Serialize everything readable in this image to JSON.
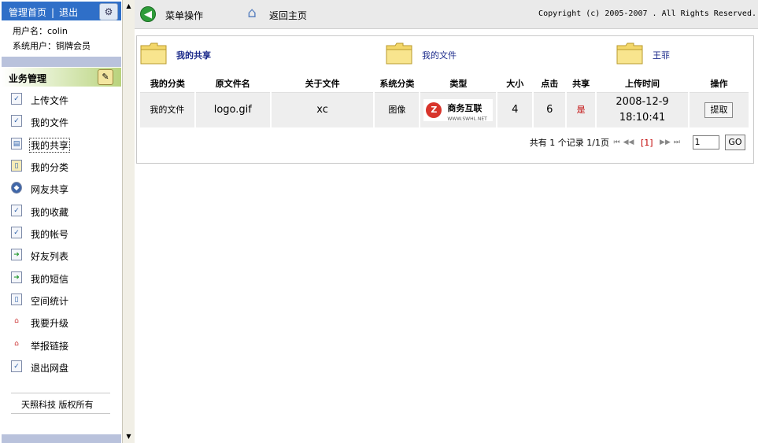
{
  "sidebar": {
    "top_home": "管理首页",
    "top_sep": "|",
    "top_logout": "退出",
    "username_line": "用户名：colin",
    "role_line": "系统用户：铜牌会员",
    "section_title": "业务管理",
    "items": [
      {
        "label": "上传文件",
        "icon": "upload-file-icon"
      },
      {
        "label": "我的文件",
        "icon": "my-files-icon"
      },
      {
        "label": "我的共享",
        "icon": "my-share-icon"
      },
      {
        "label": "我的分类",
        "icon": "category-icon"
      },
      {
        "label": "网友共享",
        "icon": "friend-share-icon"
      },
      {
        "label": "我的收藏",
        "icon": "favorites-icon"
      },
      {
        "label": "我的帐号",
        "icon": "account-icon"
      },
      {
        "label": "好友列表",
        "icon": "friends-list-icon"
      },
      {
        "label": "我的短信",
        "icon": "messages-icon"
      },
      {
        "label": "空间统计",
        "icon": "space-stats-icon"
      },
      {
        "label": "我要升级",
        "icon": "upgrade-icon"
      },
      {
        "label": "举报链接",
        "icon": "report-link-icon"
      },
      {
        "label": "退出网盘",
        "icon": "exit-icon"
      }
    ],
    "footer": "天照科技 版权所有"
  },
  "toolbar": {
    "menu_label": "菜单操作",
    "home_label": "返回主页",
    "copyright": "Copyright (c) 2005-2007 . All Rights Reserved."
  },
  "folders": [
    {
      "label": "我的共享"
    },
    {
      "label": "我的文件"
    },
    {
      "label": "王菲"
    }
  ],
  "table": {
    "headers": [
      "我的分类",
      "原文件名",
      "关于文件",
      "系统分类",
      "类型",
      "大小",
      "点击",
      "共享",
      "上传时间",
      "操作"
    ],
    "rows": [
      {
        "category": "我的文件",
        "filename": "logo.gif",
        "about": "xc",
        "sys_category": "图像",
        "type_logo_text": "商务互联",
        "type_logo_sub": "WWW.SWHL.NET",
        "size": "4",
        "clicks": "6",
        "shared": "是",
        "upload_date": "2008-12-9",
        "upload_time": "18:10:41",
        "action": "提取"
      }
    ]
  },
  "pager": {
    "total_prefix": "共有",
    "total_text": "1 个记录",
    "pages": "1/1页",
    "current": "[1]",
    "page_input": "1",
    "go": "GO"
  },
  "colors": {
    "sidebar_header": "#2f6fc8",
    "band": "#b9c2dc",
    "toolbar_bg": "#eaeaea",
    "red": "#c00000"
  }
}
